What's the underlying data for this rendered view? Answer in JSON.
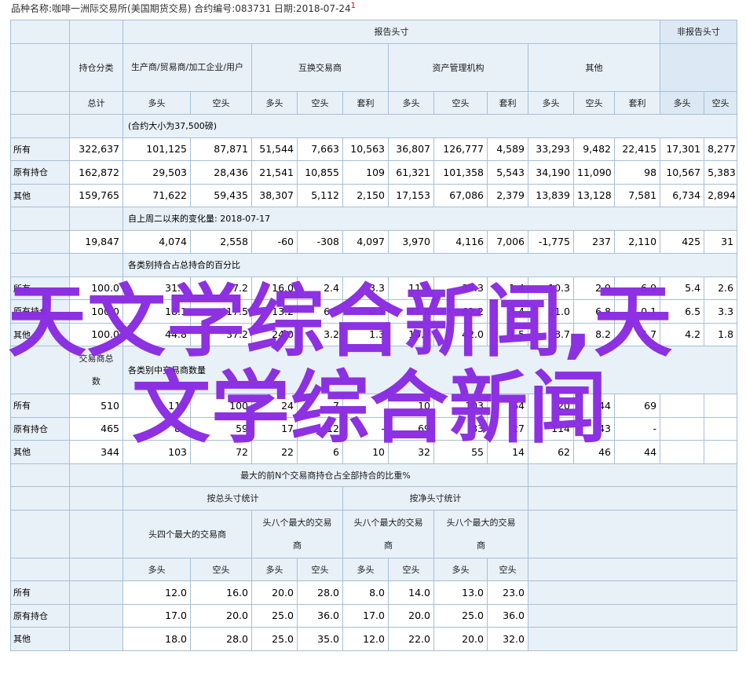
{
  "header": {
    "text": "品种名称:咖啡一洲际交易所(美国期货交易)   合约编号:083731   日期:2018-07-24",
    "mark": "1"
  },
  "labels": {
    "report": "报告头寸",
    "nonreport": "非报告头寸",
    "category": "持仓分类",
    "producer": "生产商/贸易商/加工企业/用户",
    "swap": "互换交易商",
    "mm": "资产管理机构",
    "other": "其他",
    "total": "总计",
    "long": "多头",
    "short": "空头",
    "spread": "套利"
  },
  "rows": {
    "all": "所有",
    "old": "原有持仓",
    "other": "其他"
  },
  "notes": {
    "contract_size": "(合约大小为37,500磅)",
    "change": "自上周二以来的变化量: 2018-07-17",
    "pct": "各类别持合占总持合的百分比",
    "traders_a": "交易商总",
    "traders_b": "数",
    "traders_each": "各类别中交易商数量",
    "conc_title": "最大的前N个交易商持仓占全部持合的比重%",
    "gross": "按总头寸统计",
    "net": "按净头寸统计",
    "top4": "头四个最大的交易商",
    "top8a": "头八个最大的交易",
    "top8b": "商"
  },
  "positions": {
    "all": [
      "322,637",
      "101,125",
      "87,871",
      "51,544",
      "7,663",
      "10,563",
      "36,807",
      "126,777",
      "4,589",
      "33,293",
      "9,482",
      "22,415",
      "17,301",
      "8,277"
    ],
    "old": [
      "162,872",
      "29,503",
      "28,436",
      "21,541",
      "10,855",
      "109",
      "61,321",
      "101,358",
      "5,543",
      "34,190",
      "11,090",
      "98",
      "10,567",
      "5,383"
    ],
    "other": [
      "159,765",
      "71,622",
      "59,435",
      "38,307",
      "5,112",
      "2,150",
      "17,153",
      "67,086",
      "2,379",
      "13,839",
      "13,128",
      "7,581",
      "6,734",
      "2,894"
    ]
  },
  "changes": [
    "19,847",
    "4,074",
    "2,558",
    "-60",
    "-308",
    "4,097",
    "3,970",
    "4,116",
    "7,006",
    "-1,775",
    "237",
    "2,110",
    "425",
    "31"
  ],
  "percent": {
    "all": [
      "100.0",
      "31.3",
      "27.2",
      "16.0",
      "2.4",
      "3.3",
      "11.4",
      "39.3",
      "1.4",
      "10.3",
      "2.9",
      "6.9",
      "5.4",
      "2.6"
    ],
    "old": [
      "100.0",
      "18.1",
      "17.5",
      "13.2",
      "6.7",
      "0.1",
      "37.6",
      "62.2",
      "3.4",
      "21.0",
      "6.8",
      "0.1",
      "6.5",
      "3.3"
    ],
    "other": [
      "100.0",
      "44.8",
      "37.2",
      "24.0",
      "3.2",
      "1.3",
      "10.7",
      "42.0",
      "1.5",
      "8.7",
      "8.2",
      "4.7",
      "4.2",
      "1.8"
    ]
  },
  "traders": {
    "all": [
      "510",
      "118",
      "100",
      "24",
      "7",
      "",
      "10",
      "103",
      "64",
      "20",
      "44",
      "69",
      "",
      ""
    ],
    "old": [
      "465",
      "81",
      "59",
      "17",
      "12",
      "-",
      "69",
      "83",
      "27",
      "114",
      "43",
      "-",
      "",
      ""
    ],
    "other": [
      "344",
      "103",
      "72",
      "22",
      "6",
      "10",
      "32",
      "55",
      "14",
      "62",
      "46",
      "44",
      "",
      ""
    ]
  },
  "concentration": {
    "all": [
      "12.0",
      "16.0",
      "20.0",
      "28.0",
      "8.0",
      "14.0",
      "13.0",
      "23.0"
    ],
    "old": [
      "17.0",
      "20.0",
      "25.0",
      "36.0",
      "17.0",
      "20.0",
      "25.0",
      "36.0"
    ],
    "other": [
      "18.0",
      "28.0",
      "25.0",
      "35.0",
      "12.0",
      "22.0",
      "20.0",
      "32.0"
    ]
  },
  "watermark": [
    "天文学综合新闻,天",
    "文学综合新闻"
  ],
  "colors": {
    "border": "#a6c0d8",
    "header_bg": "#e8f0f8",
    "watermark": "#8a2be2"
  }
}
